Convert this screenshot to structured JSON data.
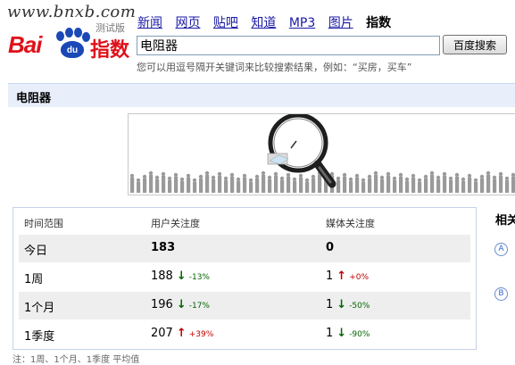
{
  "watermark": "www.bnxb.com",
  "logo": {
    "bai": "Bai",
    "du": "du",
    "index": "指数",
    "beta": "测试版"
  },
  "nav": {
    "items": [
      "新闻",
      "网页",
      "贴吧",
      "知道",
      "MP3",
      "图片"
    ],
    "current": "指数"
  },
  "search": {
    "value": "电阻器",
    "button_label": "百度搜索",
    "hint": "您可以用逗号隔开关键词来比较搜索结果，例如：“买房，买车”"
  },
  "keyword_bar": {
    "title": "电阻器"
  },
  "stats": {
    "headers": [
      "时间范围",
      "用户关注度",
      "媒体关注度"
    ],
    "rows": [
      {
        "period": "今日",
        "user": "183",
        "user_dir": "",
        "user_pct": "",
        "media": "0",
        "media_dir": "",
        "media_pct": ""
      },
      {
        "period": "1周",
        "user": "188",
        "user_dir": "↓",
        "user_pct": "-13%",
        "media": "1",
        "media_dir": "↑",
        "media_pct": "+0%"
      },
      {
        "period": "1个月",
        "user": "196",
        "user_dir": "↓",
        "user_pct": "-17%",
        "media": "1",
        "media_dir": "↓",
        "media_pct": "-50%"
      },
      {
        "period": "1季度",
        "user": "207",
        "user_dir": "↑",
        "user_pct": "+39%",
        "media": "1",
        "media_dir": "↓",
        "media_pct": "-90%"
      }
    ]
  },
  "related": {
    "title": "相关",
    "markers": [
      "A",
      "B"
    ]
  },
  "footer_note": "注：1周、1个月、1季度 平均值",
  "colors": {
    "up": "#c00000",
    "down": "#006600",
    "link": "#1a1aa6",
    "brand_red": "#e0101a",
    "brand_blue": "#1a48b6"
  }
}
